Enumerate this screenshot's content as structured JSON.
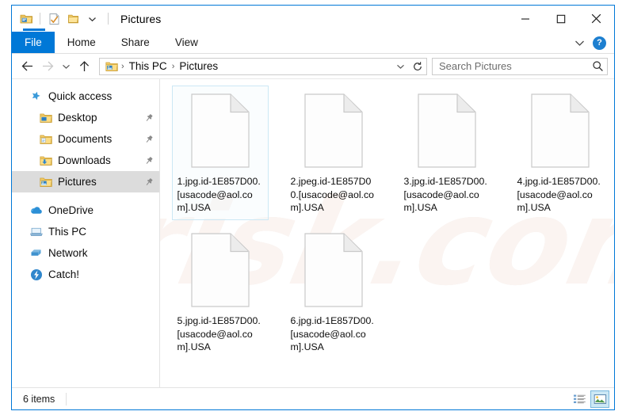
{
  "window": {
    "title": "Pictures",
    "controls": {
      "minimize": "minimize-icon",
      "maximize": "maximize-icon",
      "close": "close-icon"
    }
  },
  "quick_access_toolbar": {
    "items": [
      {
        "name": "folder-properties-icon",
        "tooltip": "Properties"
      },
      {
        "name": "properties-check-icon",
        "tooltip": "Properties"
      },
      {
        "name": "new-folder-icon",
        "tooltip": "New folder"
      },
      {
        "name": "customize-dropdown-icon",
        "tooltip": "Customize Quick Access Toolbar"
      }
    ]
  },
  "ribbon": {
    "tabs": [
      {
        "label": "File",
        "active": true
      },
      {
        "label": "Home",
        "active": false
      },
      {
        "label": "Share",
        "active": false
      },
      {
        "label": "View",
        "active": false
      }
    ],
    "expand_icon": "chevron-down-icon",
    "help_label": "?"
  },
  "navigation": {
    "back_icon": "arrow-left-icon",
    "forward_icon": "arrow-right-icon",
    "recent_icon": "chevron-down-icon",
    "up_icon": "arrow-up-icon"
  },
  "address_bar": {
    "folder_icon": "pictures-folder-icon",
    "breadcrumbs": [
      "This PC",
      "Pictures"
    ],
    "separator": "›",
    "dropdown_icon": "chevron-down-icon",
    "refresh_icon": "refresh-icon"
  },
  "search": {
    "placeholder": "Search Pictures",
    "value": "",
    "icon": "search-icon"
  },
  "sidebar": {
    "groups": [
      {
        "header": {
          "label": "Quick access",
          "icon": "star-pin-icon",
          "name": "sidebar-item-quick-access"
        },
        "items": [
          {
            "label": "Desktop",
            "icon": "desktop-folder-icon",
            "pinned": true,
            "selected": false,
            "name": "sidebar-item-desktop"
          },
          {
            "label": "Documents",
            "icon": "documents-folder-icon",
            "pinned": true,
            "selected": false,
            "name": "sidebar-item-documents"
          },
          {
            "label": "Downloads",
            "icon": "downloads-folder-icon",
            "pinned": true,
            "selected": false,
            "name": "sidebar-item-downloads"
          },
          {
            "label": "Pictures",
            "icon": "pictures-folder-icon",
            "pinned": true,
            "selected": true,
            "name": "sidebar-item-pictures"
          }
        ]
      },
      {
        "items": [
          {
            "label": "OneDrive",
            "icon": "onedrive-cloud-icon",
            "pinned": false,
            "selected": false,
            "name": "sidebar-item-onedrive"
          },
          {
            "label": "This PC",
            "icon": "this-pc-icon",
            "pinned": false,
            "selected": false,
            "name": "sidebar-item-this-pc"
          },
          {
            "label": "Network",
            "icon": "network-icon",
            "pinned": false,
            "selected": false,
            "name": "sidebar-item-network"
          },
          {
            "label": "Catch!",
            "icon": "catch-app-icon",
            "pinned": false,
            "selected": false,
            "name": "sidebar-item-catch"
          }
        ]
      }
    ]
  },
  "files": [
    {
      "name": "1.jpg.id-1E857D00.[usacode@aol.com].USA",
      "icon": "blank-document-icon",
      "focused": true
    },
    {
      "name": "2.jpeg.id-1E857D00.[usacode@aol.com].USA",
      "icon": "blank-document-icon",
      "focused": false
    },
    {
      "name": "3.jpg.id-1E857D00.[usacode@aol.com].USA",
      "icon": "blank-document-icon",
      "focused": false
    },
    {
      "name": "4.jpg.id-1E857D00.[usacode@aol.com].USA",
      "icon": "blank-document-icon",
      "focused": false
    },
    {
      "name": "5.jpg.id-1E857D00.[usacode@aol.com].USA",
      "icon": "blank-document-icon",
      "focused": false
    },
    {
      "name": "6.jpg.id-1E857D00.[usacode@aol.com].USA",
      "icon": "blank-document-icon",
      "focused": false
    }
  ],
  "status_bar": {
    "item_count": "6 items",
    "views": [
      {
        "name": "details-view-button",
        "icon": "details-view-icon",
        "active": false
      },
      {
        "name": "large-icons-view-button",
        "icon": "large-icons-view-icon",
        "active": true
      }
    ]
  },
  "watermark": {
    "text": "risk.com",
    "color": "#f0e6e2"
  },
  "colors": {
    "accent": "#0078d7",
    "selection": "#cce8f5",
    "sidebar_selected": "#dcdcdc"
  }
}
